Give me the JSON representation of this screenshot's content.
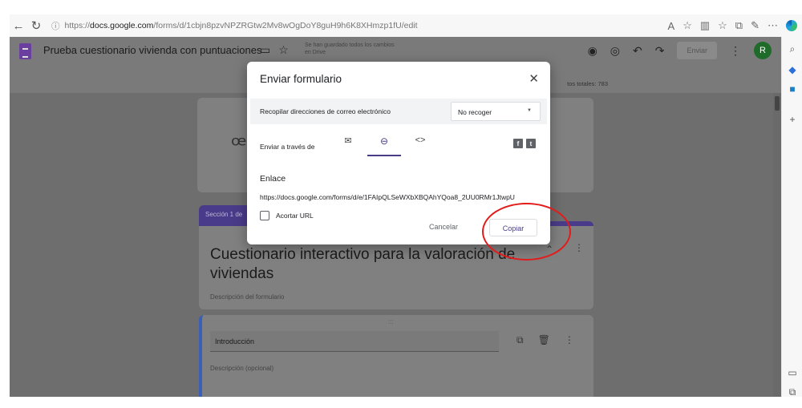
{
  "browser": {
    "url_prefix": "https://",
    "url_host": "docs.google.com",
    "url_path": "/forms/d/1cbjn8pzvNPZRGtw2Mv8wOgDoY8guH9h6K8XHmzp1fU/edit"
  },
  "forms_header": {
    "doc_title": "Prueba  cuestionario vivienda con puntuaciones",
    "save_status": "Se han guardado todos los cambios en Drive",
    "send_button": "Enviar",
    "avatar_letter": "R",
    "total_points": "tos totales: 783"
  },
  "dialog": {
    "title": "Enviar formulario",
    "collect_label": "Recopilar direcciones de correo electrónico",
    "collect_value": "No recoger",
    "send_via_label": "Enviar a través de",
    "link_heading": "Enlace",
    "link_url": "https://docs.google.com/forms/d/e/1FAIpQLSeWXbXBQAhYQoa8_2UU0RMr1JtwpU",
    "shorten_label": "Acortar URL",
    "cancel_label": "Cancelar",
    "copy_label": "Copiar"
  },
  "form": {
    "section_chip": "Sección 1 de",
    "title": "Cuestionario interactivo para la valoración de viviendas",
    "description_placeholder": "Descripción del formulario",
    "section_title": "Introducción",
    "section_description_placeholder": "Descripción (opcional)"
  },
  "colors": {
    "accent": "#4a3b8a",
    "highlight": "#e21b1b"
  }
}
